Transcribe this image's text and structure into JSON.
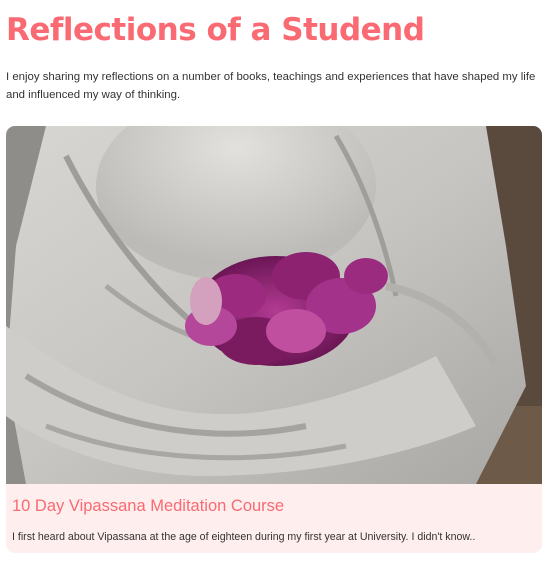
{
  "header": {
    "title": "Reflections of a Studend",
    "intro": "I enjoy sharing my reflections on a number of books, teachings and experiences that have shaped my life and influenced my way of thinking."
  },
  "post": {
    "image_icon": "buddha-statue-with-flowers-image",
    "title": "10 Day Vipassana Meditation Course",
    "excerpt": "I first heard about Vipassana at the age of eighteen during my first year at University. I didn't know.."
  },
  "colors": {
    "accent": "#f96a72",
    "card_background": "#ffeeee",
    "text": "#333333"
  }
}
